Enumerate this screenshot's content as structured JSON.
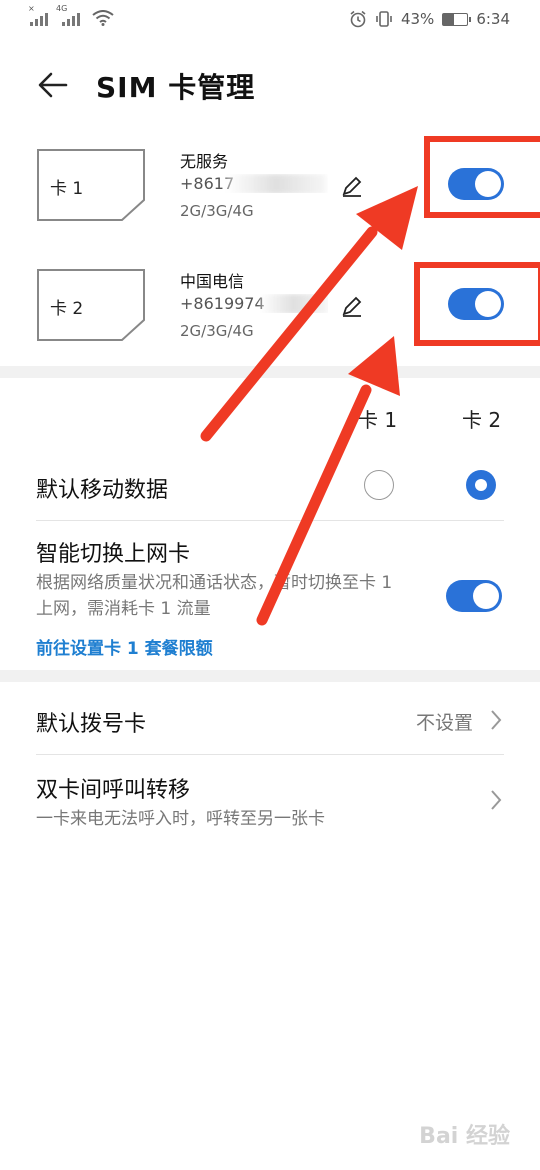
{
  "status_bar": {
    "signal1_label": "×",
    "signal2_label": "4G",
    "battery_percent": "43%",
    "battery_level": 0.43,
    "time": "6:34"
  },
  "header": {
    "title": "SIM 卡管理"
  },
  "sims": [
    {
      "name": "卡 1",
      "carrier": "无服务",
      "number": "+8617",
      "network": "2G/3G/4G",
      "enabled": true
    },
    {
      "name": "卡 2",
      "carrier": "中国电信",
      "number": "+8619974",
      "network": "2G/3G/4G",
      "enabled": true
    }
  ],
  "columns": {
    "card1": "卡 1",
    "card2": "卡 2"
  },
  "default_data": {
    "label": "默认移动数据",
    "selected": "卡 2"
  },
  "smart_switch": {
    "label": "智能切换上网卡",
    "description": "根据网络质量状况和通话状态，暂时切换至卡 1 上网，需消耗卡 1 流量",
    "link": "前往设置卡 1 套餐限额",
    "enabled": true
  },
  "default_dial": {
    "label": "默认拨号卡",
    "value": "不设置"
  },
  "call_forward": {
    "label": "双卡间呼叫转移",
    "description": "一卡来电无法呼入时，呼转至另一张卡"
  },
  "watermark": "Bai 经验",
  "colors": {
    "accent": "#2a72d8",
    "link": "#1f7fd1",
    "annotation": "#ef3a24"
  },
  "icons": {
    "back": "arrow-left-icon",
    "edit": "pencil-icon",
    "chevron": "chevron-right-icon",
    "alarm": "alarm-icon",
    "vibrate": "vibrate-icon",
    "wifi": "wifi-icon"
  }
}
